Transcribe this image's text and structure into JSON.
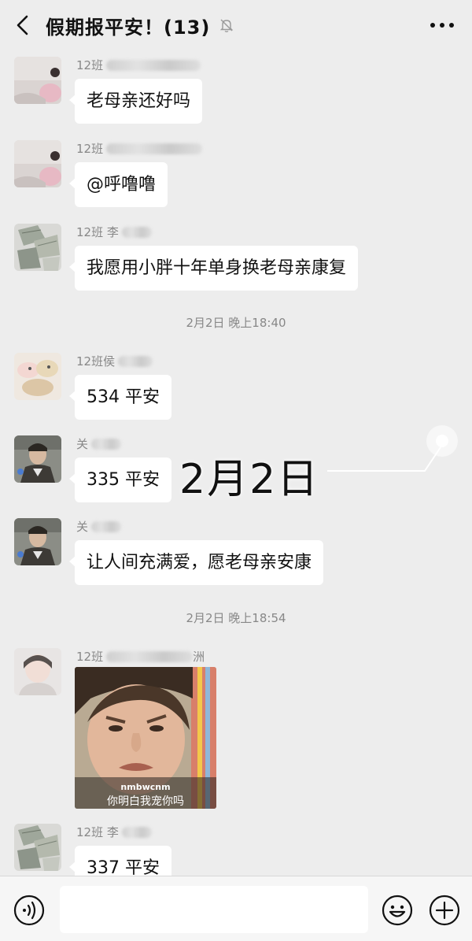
{
  "header": {
    "title": "假期报平安！(13)",
    "back_icon": "chevron-left-icon",
    "mute_icon": "bell-off-icon",
    "more_icon": "more-dots-icon"
  },
  "messages": [
    {
      "sender_prefix": "12班",
      "text": "老母亲还好吗",
      "avatar": "photo-avatar"
    },
    {
      "sender_prefix": "12班",
      "text": "@呼噜噜",
      "avatar": "photo-avatar"
    },
    {
      "sender_prefix": "12班 李",
      "text": "我愿用小胖十年单身换老母亲康复",
      "avatar": "money-avatar"
    },
    {
      "sender_prefix": "12班侯",
      "text": "534 平安",
      "avatar": "toy-avatar"
    },
    {
      "sender_prefix": "关",
      "text": "335 平安",
      "avatar": "person-avatar"
    },
    {
      "sender_prefix": "关",
      "text": "让人间充满爱，愿老母亲安康",
      "avatar": "person-avatar"
    },
    {
      "sender_prefix": "12班",
      "sender_suffix": "洲",
      "avatar": "selfie-avatar"
    },
    {
      "sender_prefix": "12班 李",
      "text": "337 平安",
      "avatar": "money-avatar"
    }
  ],
  "timestamps": [
    "2月2日 晚上18:40",
    "2月2日 晚上18:54"
  ],
  "sticker": {
    "watermark": "nmbwcnm",
    "caption": "你明白我宠你吗"
  },
  "overlay": {
    "date_text": "2月2日"
  },
  "input_bar": {
    "placeholder": "",
    "voice_icon": "voice-icon",
    "emoji_icon": "emoji-icon",
    "plus_icon": "plus-icon"
  },
  "colors": {
    "background": "#ededed",
    "bubble": "#ffffff",
    "meta_text": "#888888"
  }
}
